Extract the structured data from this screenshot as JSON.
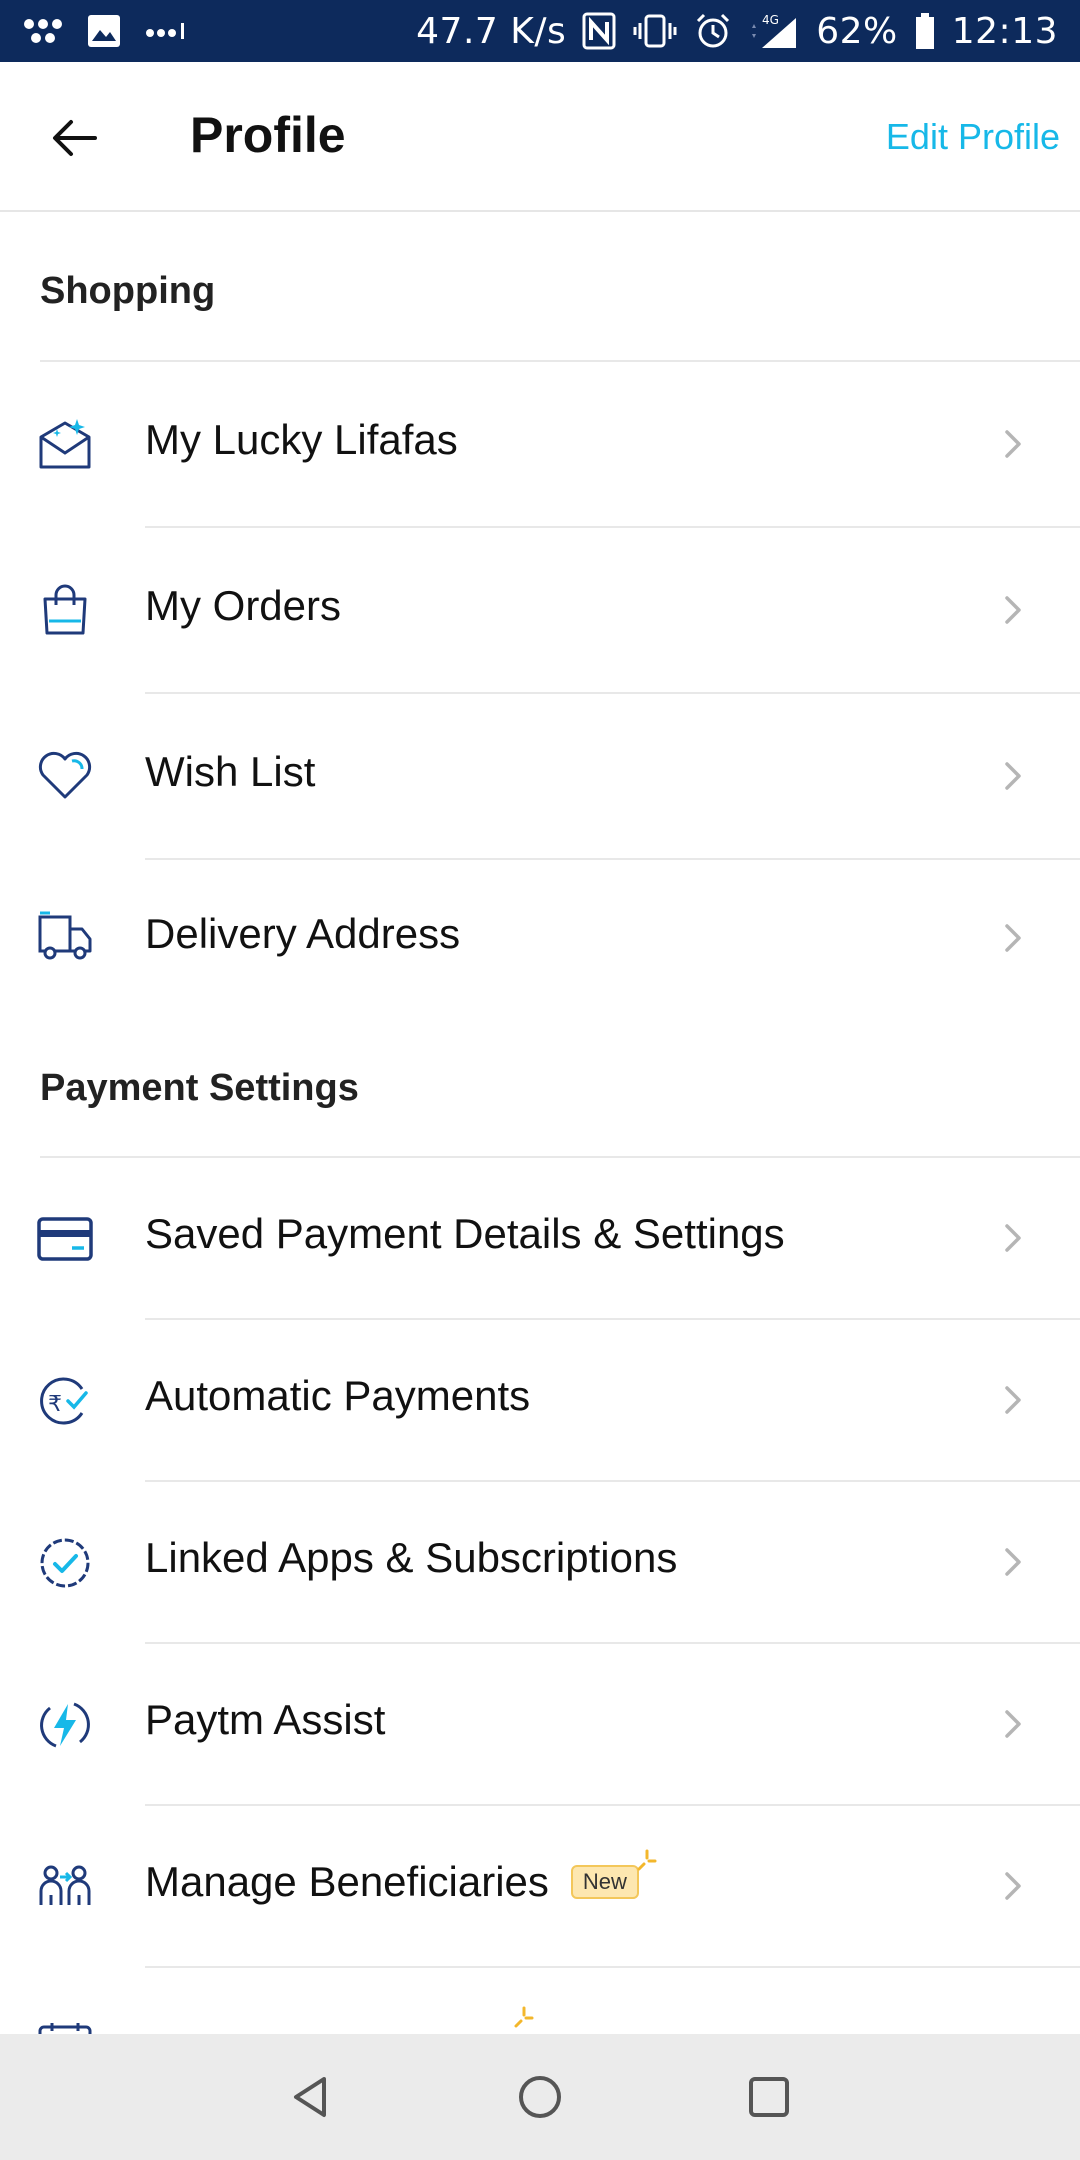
{
  "status_bar": {
    "speed": "47.7 K/s",
    "network": "4G",
    "battery": "62%",
    "time": "12:13"
  },
  "header": {
    "title": "Profile",
    "edit_label": "Edit Profile"
  },
  "colors": {
    "status_bar_bg": "#0d2a5c",
    "accent": "#17b8e8",
    "icon_navy": "#1f3a7a"
  },
  "sections": {
    "shopping": {
      "title": "Shopping",
      "items": [
        {
          "label": "My Lucky Lifafas",
          "icon": "envelope-icon"
        },
        {
          "label": "My Orders",
          "icon": "shopping-bag-icon"
        },
        {
          "label": "Wish List",
          "icon": "heart-icon"
        },
        {
          "label": "Delivery Address",
          "icon": "truck-icon"
        }
      ]
    },
    "payment": {
      "title": "Payment Settings",
      "items": [
        {
          "label": "Saved Payment Details & Settings",
          "icon": "card-icon"
        },
        {
          "label": "Automatic Payments",
          "icon": "rupee-refresh-icon"
        },
        {
          "label": "Linked Apps & Subscriptions",
          "icon": "verified-badge-icon"
        },
        {
          "label": "Paytm Assist",
          "icon": "lightning-icon"
        },
        {
          "label": "Manage Beneficiaries",
          "icon": "people-icon",
          "badge": "New"
        }
      ]
    }
  }
}
